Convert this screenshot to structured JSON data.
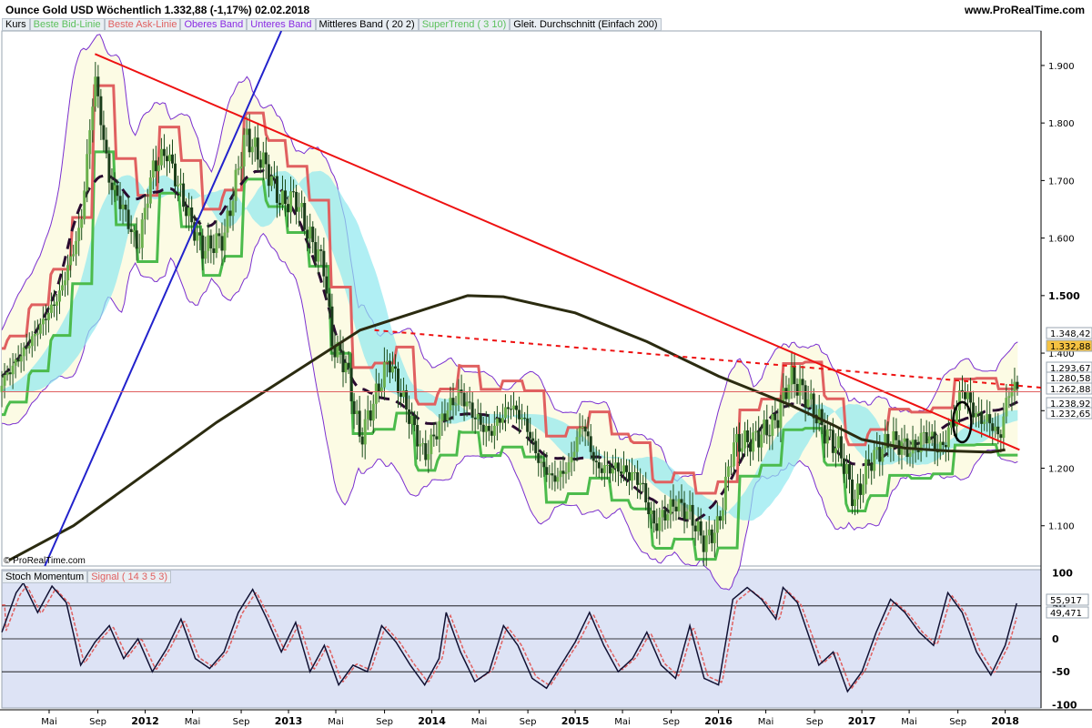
{
  "header": {
    "title": "Ounce Gold USD   Wöchentlich   1.332,88 (-1,17%)   02.02.2018",
    "site": "www.ProRealTime.com"
  },
  "legend": [
    {
      "label": "Kurs",
      "color": "#000000"
    },
    {
      "label": "Beste Bid-Linie",
      "color": "#5cc05c"
    },
    {
      "label": "Beste Ask-Linie",
      "color": "#e06060"
    },
    {
      "label": "Oberes Band",
      "color": "#8a2be2"
    },
    {
      "label": "Unteres Band",
      "color": "#8a2be2"
    },
    {
      "label": "Mittleres Band ( 20 2)",
      "color": "#000000"
    },
    {
      "label": "SuperTrend ( 3 10)",
      "color": "#5cc05c"
    },
    {
      "label": "Gleit. Durchschnitt (Einfach 200)",
      "color": "#000000"
    }
  ],
  "copyright": "© ProRealTime.com",
  "price_labels": [
    {
      "text": "1.348,42",
      "bg": "#ffffff",
      "fg": "#e06060"
    },
    {
      "text": "1.332,88",
      "bg": "#f5c242",
      "fg": "#000000"
    },
    {
      "text": "1.293,67",
      "bg": "#ffffff",
      "fg": "#000000"
    },
    {
      "text": "1.280,58",
      "bg": "#ffffff",
      "fg": "#3cb043"
    },
    {
      "text": "1.262,88",
      "bg": "#ffffff",
      "fg": "#3cb043"
    },
    {
      "text": "1.238,92",
      "bg": "#ffffff",
      "fg": "#e06060"
    },
    {
      "text": "1.232,65",
      "bg": "#ffffff",
      "fg": "#000000"
    }
  ],
  "osc": {
    "legend": [
      {
        "label": "Stoch Momentum",
        "color": "#000000"
      },
      {
        "label": "Signal ( 14 3 5 3)",
        "color": "#e06060"
      }
    ],
    "labels": [
      {
        "text": "55,917",
        "fg": "#000000"
      },
      {
        "text": "49,471",
        "fg": "#e06060"
      }
    ],
    "ticks": [
      "100",
      "50",
      "0",
      "-50",
      "-100"
    ]
  },
  "chart_data": {
    "type": "candlestick",
    "title": "Ounce Gold USD Wöchentlich",
    "ylim": [
      1030,
      1960
    ],
    "y_ticks": [
      "1.900",
      "1.800",
      "1.700",
      "1.600",
      "1.500",
      "1.400",
      "1.300",
      "1.200",
      "1.100"
    ],
    "x_ticks": [
      {
        "label": "Mai",
        "t": 2011.33,
        "bold": false
      },
      {
        "label": "Sep",
        "t": 2011.67,
        "bold": false
      },
      {
        "label": "2012",
        "t": 2012.0,
        "bold": true
      },
      {
        "label": "Mai",
        "t": 2012.33,
        "bold": false
      },
      {
        "label": "Sep",
        "t": 2012.67,
        "bold": false
      },
      {
        "label": "2013",
        "t": 2013.0,
        "bold": true
      },
      {
        "label": "Mai",
        "t": 2013.33,
        "bold": false
      },
      {
        "label": "Sep",
        "t": 2013.67,
        "bold": false
      },
      {
        "label": "2014",
        "t": 2014.0,
        "bold": true
      },
      {
        "label": "Mai",
        "t": 2014.33,
        "bold": false
      },
      {
        "label": "Sep",
        "t": 2014.67,
        "bold": false
      },
      {
        "label": "2015",
        "t": 2015.0,
        "bold": true
      },
      {
        "label": "Mai",
        "t": 2015.33,
        "bold": false
      },
      {
        "label": "Sep",
        "t": 2015.67,
        "bold": false
      },
      {
        "label": "2016",
        "t": 2016.0,
        "bold": true
      },
      {
        "label": "Mai",
        "t": 2016.33,
        "bold": false
      },
      {
        "label": "Sep",
        "t": 2016.67,
        "bold": false
      },
      {
        "label": "2017",
        "t": 2017.0,
        "bold": true
      },
      {
        "label": "Mai",
        "t": 2017.33,
        "bold": false
      },
      {
        "label": "Sep",
        "t": 2017.67,
        "bold": false
      },
      {
        "label": "2018",
        "t": 2018.0,
        "bold": true
      }
    ],
    "x_range": [
      2011.0,
      2018.25
    ],
    "close_path": [
      [
        2011.0,
        1350
      ],
      [
        2011.2,
        1420
      ],
      [
        2011.4,
        1500
      ],
      [
        2011.55,
        1620
      ],
      [
        2011.65,
        1880
      ],
      [
        2011.75,
        1700
      ],
      [
        2011.85,
        1650
      ],
      [
        2011.95,
        1580
      ],
      [
        2012.05,
        1720
      ],
      [
        2012.15,
        1750
      ],
      [
        2012.3,
        1640
      ],
      [
        2012.4,
        1580
      ],
      [
        2012.55,
        1600
      ],
      [
        2012.7,
        1780
      ],
      [
        2012.85,
        1720
      ],
      [
        2012.95,
        1660
      ],
      [
        2013.05,
        1670
      ],
      [
        2013.15,
        1600
      ],
      [
        2013.25,
        1550
      ],
      [
        2013.3,
        1420
      ],
      [
        2013.4,
        1380
      ],
      [
        2013.5,
        1250
      ],
      [
        2013.6,
        1320
      ],
      [
        2013.7,
        1390
      ],
      [
        2013.8,
        1320
      ],
      [
        2013.95,
        1220
      ],
      [
        2014.1,
        1300
      ],
      [
        2014.2,
        1330
      ],
      [
        2014.3,
        1290
      ],
      [
        2014.4,
        1260
      ],
      [
        2014.55,
        1310
      ],
      [
        2014.65,
        1280
      ],
      [
        2014.75,
        1210
      ],
      [
        2014.85,
        1180
      ],
      [
        2014.95,
        1200
      ],
      [
        2015.05,
        1280
      ],
      [
        2015.15,
        1200
      ],
      [
        2015.3,
        1200
      ],
      [
        2015.45,
        1180
      ],
      [
        2015.55,
        1100
      ],
      [
        2015.7,
        1140
      ],
      [
        2015.8,
        1120
      ],
      [
        2015.9,
        1070
      ],
      [
        2016.0,
        1100
      ],
      [
        2016.1,
        1240
      ],
      [
        2016.25,
        1250
      ],
      [
        2016.4,
        1280
      ],
      [
        2016.5,
        1360
      ],
      [
        2016.6,
        1330
      ],
      [
        2016.75,
        1260
      ],
      [
        2016.85,
        1230
      ],
      [
        2016.95,
        1140
      ],
      [
        2017.05,
        1210
      ],
      [
        2017.2,
        1250
      ],
      [
        2017.35,
        1230
      ],
      [
        2017.45,
        1260
      ],
      [
        2017.55,
        1230
      ],
      [
        2017.65,
        1290
      ],
      [
        2017.7,
        1340
      ],
      [
        2017.8,
        1290
      ],
      [
        2017.9,
        1280
      ],
      [
        2017.96,
        1250
      ],
      [
        2018.02,
        1330
      ],
      [
        2018.08,
        1345
      ],
      [
        2018.09,
        1333
      ]
    ],
    "sma200": [
      [
        2011.05,
        1040
      ],
      [
        2011.5,
        1100
      ],
      [
        2012.0,
        1190
      ],
      [
        2012.5,
        1280
      ],
      [
        2013.0,
        1360
      ],
      [
        2013.5,
        1440
      ],
      [
        2014.0,
        1480
      ],
      [
        2014.25,
        1500
      ],
      [
        2014.5,
        1498
      ],
      [
        2015.0,
        1470
      ],
      [
        2015.5,
        1420
      ],
      [
        2016.0,
        1360
      ],
      [
        2016.5,
        1310
      ],
      [
        2016.8,
        1275
      ],
      [
        2017.0,
        1250
      ],
      [
        2017.3,
        1235
      ],
      [
        2017.6,
        1230
      ],
      [
        2017.9,
        1228
      ],
      [
        2018.0,
        1232
      ]
    ],
    "trendlines": [
      {
        "from": [
          2011.65,
          1920
        ],
        "to": [
          2018.1,
          1232
        ],
        "color": "#ee1111",
        "dashed": false
      },
      {
        "from": [
          2013.6,
          1440
        ],
        "to": [
          2018.25,
          1340
        ],
        "color": "#ee1111",
        "dashed": true
      },
      {
        "from": [
          2011.3,
          1030
        ],
        "to": [
          2012.95,
          1960
        ],
        "color": "#2222cc",
        "dashed": false
      }
    ],
    "hline": 1332.88,
    "osc_range": [
      -105,
      105
    ],
    "stoch": [
      [
        2011.0,
        10
      ],
      [
        2011.1,
        70
      ],
      [
        2011.15,
        85
      ],
      [
        2011.25,
        40
      ],
      [
        2011.35,
        80
      ],
      [
        2011.45,
        55
      ],
      [
        2011.55,
        -40
      ],
      [
        2011.65,
        -5
      ],
      [
        2011.75,
        20
      ],
      [
        2011.85,
        -30
      ],
      [
        2011.95,
        0
      ],
      [
        2012.05,
        -50
      ],
      [
        2012.15,
        -15
      ],
      [
        2012.25,
        30
      ],
      [
        2012.35,
        -30
      ],
      [
        2012.45,
        -45
      ],
      [
        2012.55,
        -20
      ],
      [
        2012.65,
        40
      ],
      [
        2012.75,
        75
      ],
      [
        2012.85,
        30
      ],
      [
        2012.95,
        -20
      ],
      [
        2013.05,
        25
      ],
      [
        2013.15,
        -50
      ],
      [
        2013.25,
        -10
      ],
      [
        2013.35,
        -70
      ],
      [
        2013.45,
        -40
      ],
      [
        2013.55,
        -50
      ],
      [
        2013.65,
        20
      ],
      [
        2013.75,
        -5
      ],
      [
        2013.85,
        -40
      ],
      [
        2013.95,
        -70
      ],
      [
        2014.05,
        -30
      ],
      [
        2014.1,
        40
      ],
      [
        2014.2,
        -20
      ],
      [
        2014.3,
        -65
      ],
      [
        2014.4,
        -50
      ],
      [
        2014.5,
        20
      ],
      [
        2014.6,
        -10
      ],
      [
        2014.7,
        -60
      ],
      [
        2014.8,
        -75
      ],
      [
        2014.9,
        -40
      ],
      [
        2015.0,
        -5
      ],
      [
        2015.1,
        40
      ],
      [
        2015.2,
        -10
      ],
      [
        2015.3,
        -50
      ],
      [
        2015.4,
        -30
      ],
      [
        2015.5,
        10
      ],
      [
        2015.6,
        -40
      ],
      [
        2015.7,
        -60
      ],
      [
        2015.8,
        20
      ],
      [
        2015.9,
        -60
      ],
      [
        2016.0,
        -70
      ],
      [
        2016.1,
        60
      ],
      [
        2016.2,
        78
      ],
      [
        2016.3,
        60
      ],
      [
        2016.4,
        30
      ],
      [
        2016.45,
        78
      ],
      [
        2016.55,
        55
      ],
      [
        2016.7,
        -40
      ],
      [
        2016.8,
        -20
      ],
      [
        2016.9,
        -80
      ],
      [
        2017.0,
        -50
      ],
      [
        2017.1,
        10
      ],
      [
        2017.2,
        60
      ],
      [
        2017.3,
        40
      ],
      [
        2017.4,
        10
      ],
      [
        2017.5,
        -10
      ],
      [
        2017.6,
        70
      ],
      [
        2017.7,
        40
      ],
      [
        2017.8,
        -20
      ],
      [
        2017.9,
        -55
      ],
      [
        2018.0,
        -10
      ],
      [
        2018.08,
        54
      ]
    ]
  }
}
